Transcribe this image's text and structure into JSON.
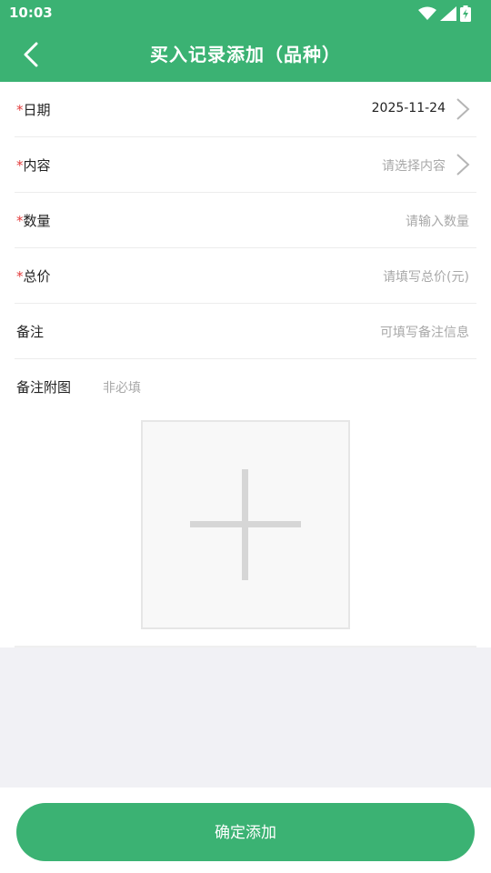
{
  "status_bar": {
    "time": "10:03",
    "icons": [
      "wifi-icon",
      "signal-icon",
      "battery-charging-icon"
    ]
  },
  "navbar": {
    "title": "买入记录添加（品种）",
    "back_icon": "chevron-left-icon"
  },
  "form": {
    "date": {
      "required_mark": "*",
      "label": "日期",
      "value": "2025-11-24"
    },
    "content": {
      "required_mark": "*",
      "label": "内容",
      "placeholder": "请选择内容"
    },
    "quantity": {
      "required_mark": "*",
      "label": "数量",
      "placeholder": "请输入数量"
    },
    "total_price": {
      "required_mark": "*",
      "label": "总价",
      "placeholder": "请填写总价(元)"
    },
    "remark": {
      "label": "备注",
      "placeholder": "可填写备注信息"
    },
    "attachment": {
      "label": "备注附图",
      "hint": "非必填",
      "upload_icon": "plus-icon"
    }
  },
  "footer": {
    "submit_label": "确定添加"
  },
  "colors": {
    "accent": "#3bb273",
    "required": "#e23b3b",
    "placeholder": "#a8a8a8"
  }
}
